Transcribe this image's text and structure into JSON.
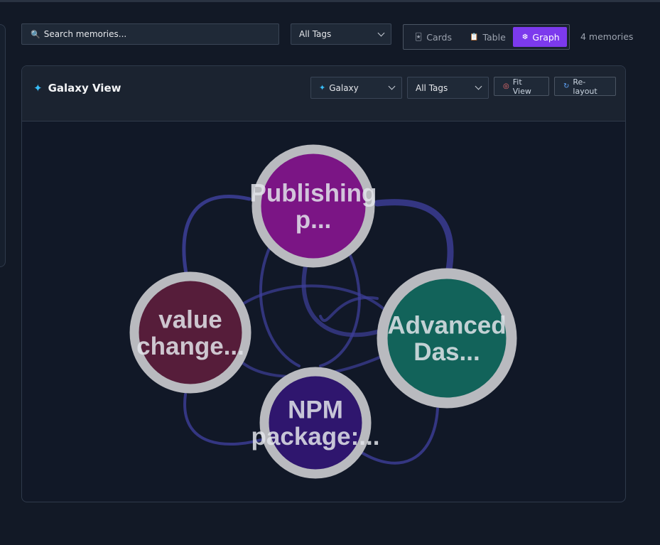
{
  "toolbar": {
    "search_placeholder": "Search memories...",
    "tag_filter": "All Tags",
    "views": [
      {
        "icon": "cards-icon",
        "label": "Cards"
      },
      {
        "icon": "table-icon",
        "label": "Table"
      },
      {
        "icon": "graph-icon",
        "label": "Graph",
        "active": true
      }
    ],
    "count": "4 memories"
  },
  "panel": {
    "title": "Galaxy View",
    "layout_select": "Galaxy",
    "tag_select": "All Tags",
    "fit_view": "Fit View",
    "relayout": "Re-layout"
  },
  "graph": {
    "edge_color": "#3d3f9a",
    "nodes": [
      {
        "id": "publishing",
        "lines": [
          "Publishing",
          "p..."
        ],
        "color": "#7b1585"
      },
      {
        "id": "value",
        "lines": [
          "value",
          "change..."
        ],
        "color": "#561d3a"
      },
      {
        "id": "advanced",
        "lines": [
          "Advanced",
          "Das..."
        ],
        "color": "#12635a"
      },
      {
        "id": "npm",
        "lines": [
          "NPM",
          "package:..."
        ],
        "color": "#2f166e"
      }
    ]
  }
}
